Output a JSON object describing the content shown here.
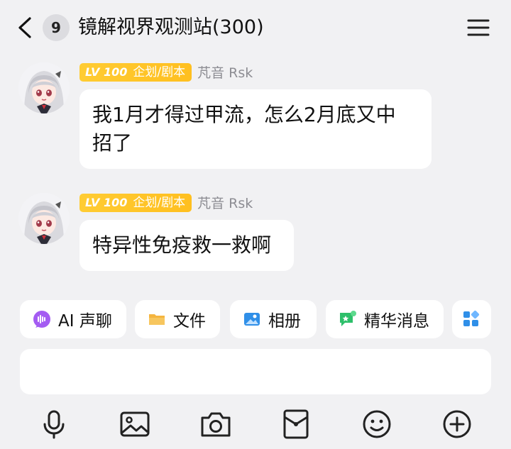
{
  "header": {
    "unread_count": "9",
    "title": "镜解视界观测站(300)",
    "back_icon": "chevron-left-icon",
    "menu_icon": "hamburger-menu-icon"
  },
  "messages": [
    {
      "level": "LV 100",
      "role": "企划/剧本",
      "sender": "芃音 Rsk",
      "text_line1": "我1月才得过甲流，怎么2月底又中",
      "text_line2": "招了"
    },
    {
      "level": "LV 100",
      "role": "企划/剧本",
      "sender": "芃音 Rsk",
      "text_line1": "特异性免疫救一救啊"
    }
  ],
  "quick_actions": [
    {
      "label": "AI 声聊",
      "icon": "ai-voice-icon"
    },
    {
      "label": "文件",
      "icon": "folder-icon"
    },
    {
      "label": "相册",
      "icon": "album-icon"
    },
    {
      "label": "精华消息",
      "icon": "essence-message-icon"
    },
    {
      "label": "",
      "icon": "apps-grid-icon"
    }
  ],
  "input": {
    "value": "",
    "placeholder": ""
  },
  "toolbar": [
    "microphone-icon",
    "image-icon",
    "camera-icon",
    "red-packet-icon",
    "emoji-icon",
    "plus-icon"
  ],
  "colors": {
    "background": "#f1f1f3",
    "level_tag": "#ffc42a",
    "ai_purple": "#a45cf2",
    "folder_orange": "#f5b53f",
    "album_blue": "#2f8fe8",
    "essence_green": "#2dbf6a"
  }
}
